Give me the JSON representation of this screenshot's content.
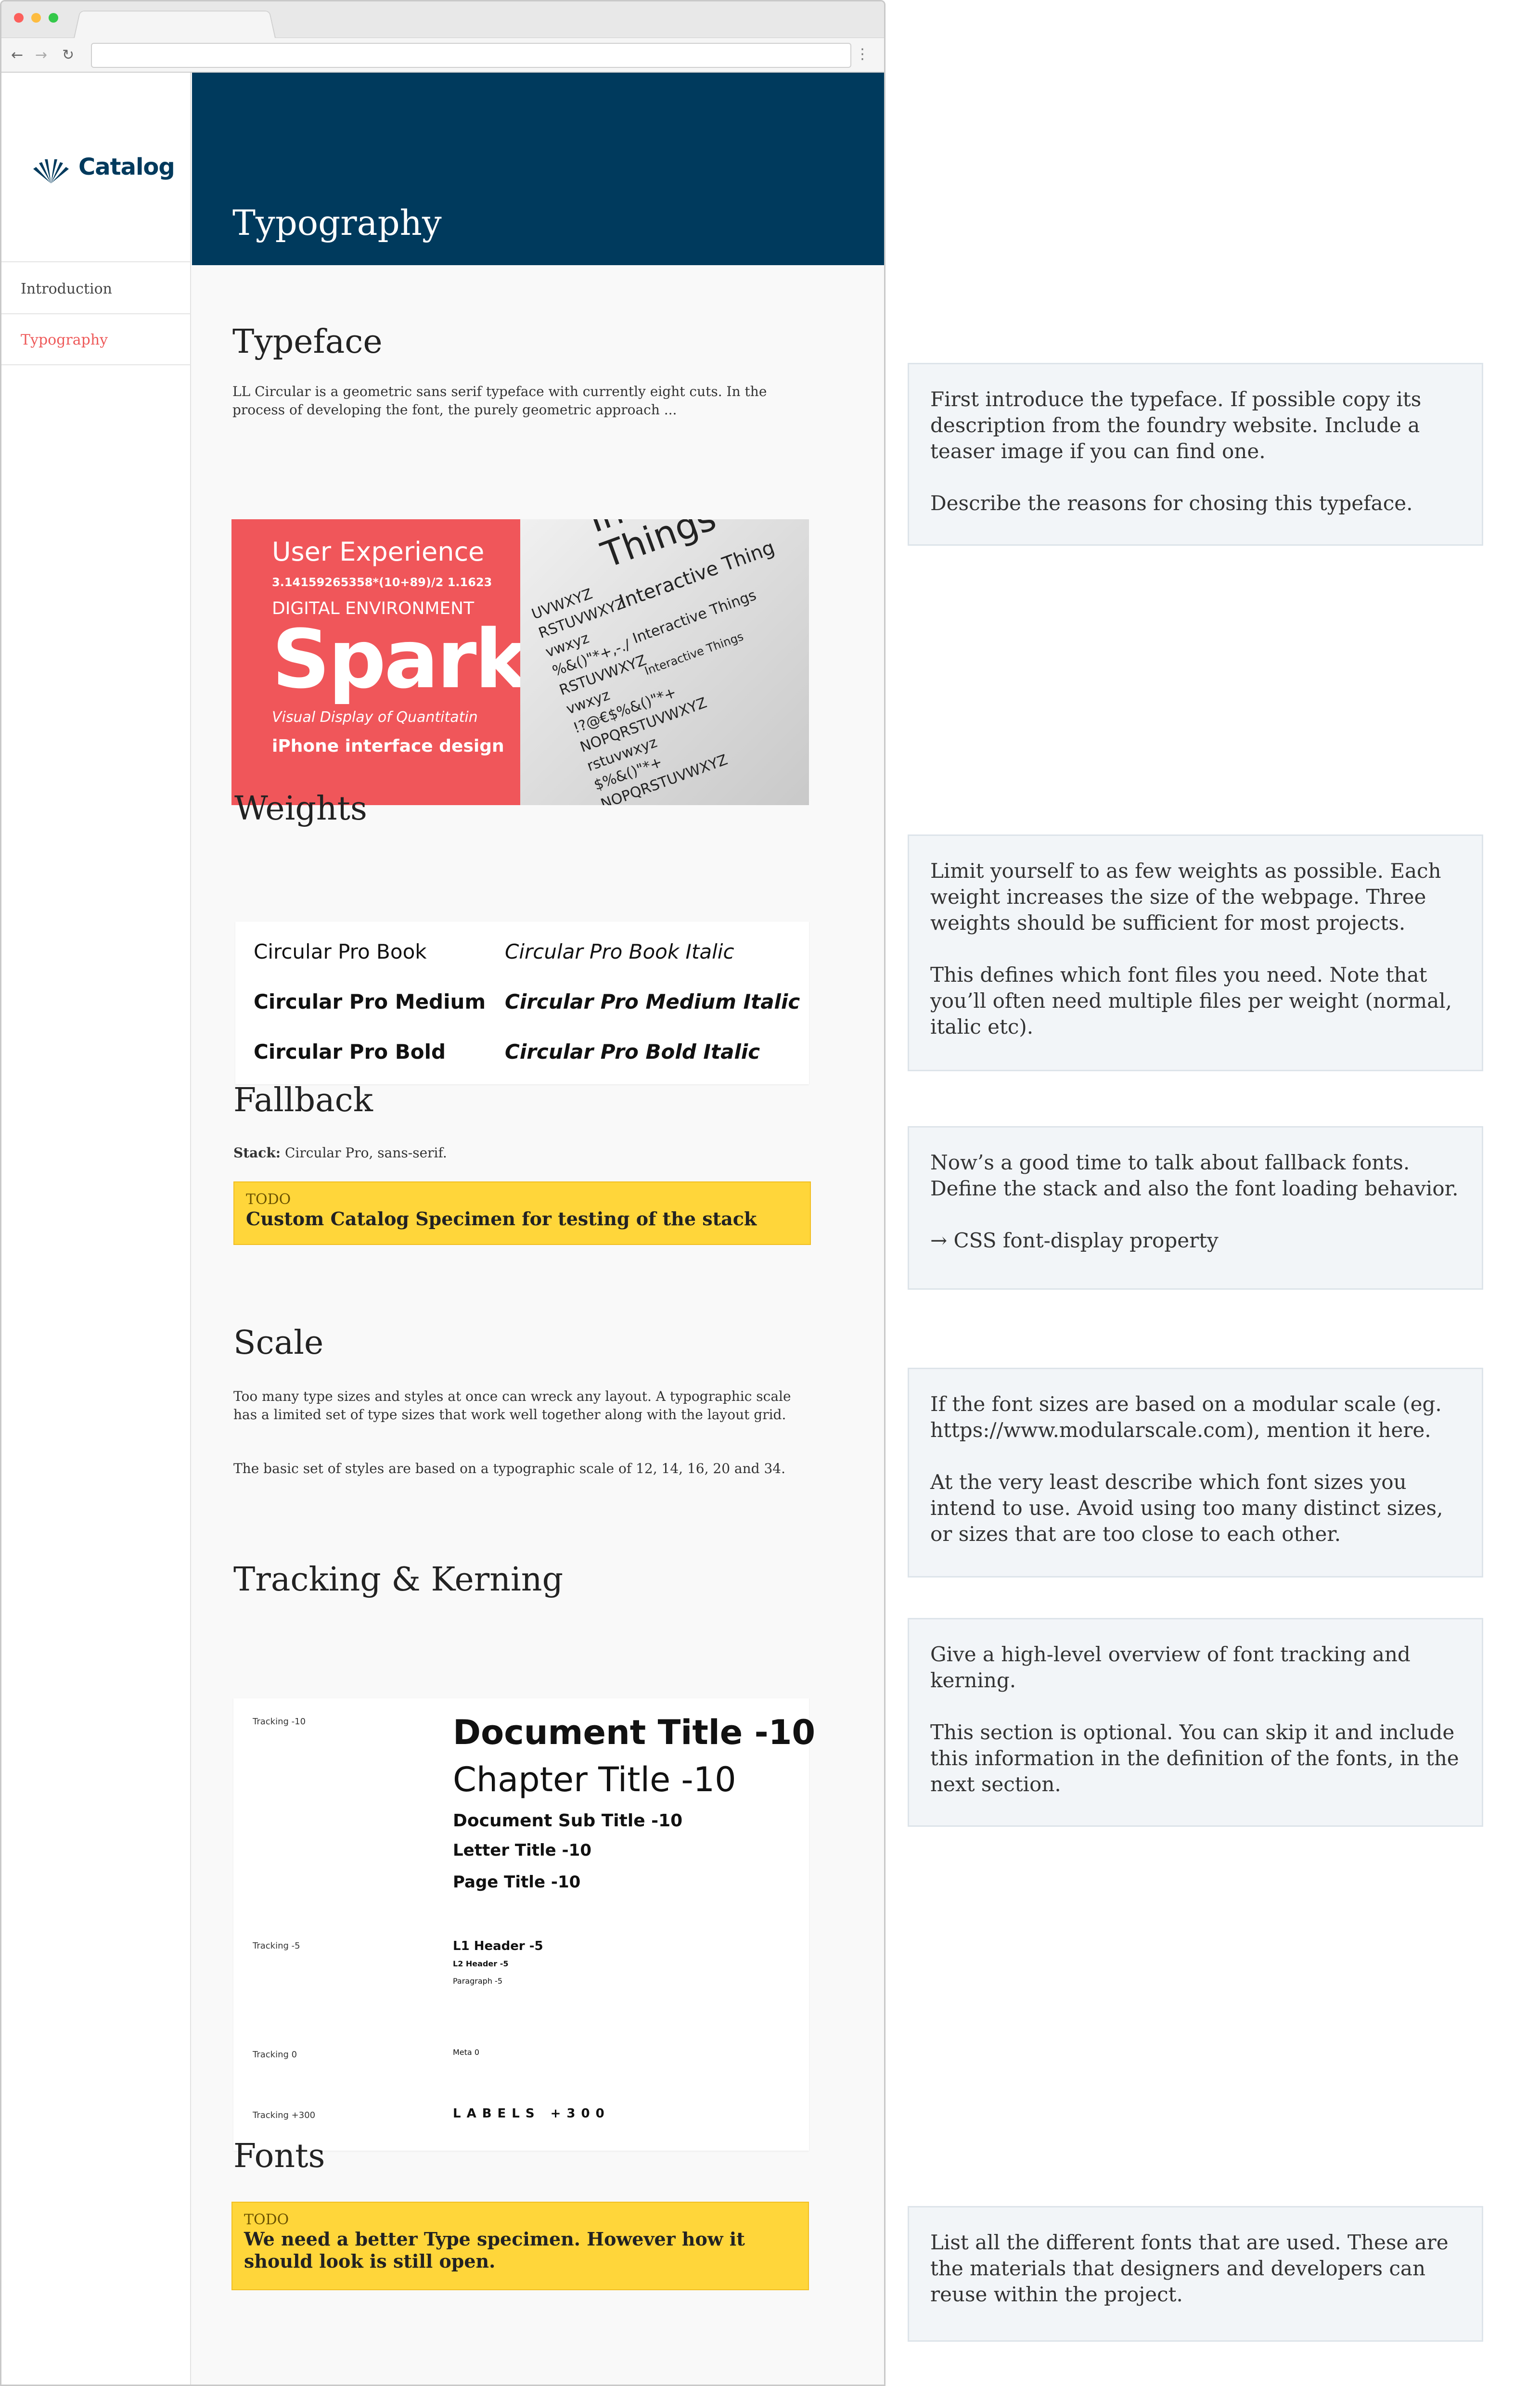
{
  "browser": {
    "url": "",
    "back_icon": "←",
    "forward_icon": "→",
    "reload_icon": "↻",
    "menu_icon": "⋮"
  },
  "sidebar": {
    "logo_text": "Catalog",
    "items": [
      {
        "label": "Introduction",
        "active": false
      },
      {
        "label": "Typography",
        "active": true
      }
    ]
  },
  "header": {
    "title": "Typography"
  },
  "sections": {
    "typeface": {
      "heading": "Typeface",
      "text": "LL Circular is a geometric sans serif typeface with currently eight cuts. In the process of developing the font, the purely geometric approach ...",
      "image": {
        "ux": "User Experience",
        "numbers": "3.14159265358*(10+89)/2   1.1623",
        "digital": "DIGITAL ENVIRONMENT",
        "spark": "Spark",
        "visual": "Visual Display of Quantitatin",
        "iphone": "iPhone interface design",
        "alphabet": "UVWXYZ\nRSTUVWXYZ\nvwxyz\n%&()\"*+,-./\nRSTUVWXYZ\nvwxyz\n!?@€$%&()\"*+\nNOPQRSTUVWXYZ\nrstuvwxyz\n$%&()\"*+\nNOPQRSTUVWXYZ\nwxyz\n@€$%&()\"*",
        "interactive_big": "Interactive Things",
        "interactive": "Interactive Thing"
      }
    },
    "weights": {
      "heading": "Weights",
      "items": [
        "Circular Pro Book",
        "Circular Pro Book Italic",
        "Circular Pro Medium",
        "Circular Pro Medium Italic",
        "Circular Pro Bold",
        "Circular Pro Bold Italic"
      ]
    },
    "fallback": {
      "heading": "Fallback",
      "stack_label": "Stack:",
      "stack_value": "Circular Pro, sans-serif.",
      "todo_label": "TODO",
      "todo_text": "Custom Catalog Specimen for testing of the stack"
    },
    "scale": {
      "heading": "Scale",
      "text1": "Too many type sizes and styles at once can wreck any layout. A typographic scale has a limited set of type sizes that work well together along with the layout grid.",
      "text2": "The basic set of styles are based on a typographic scale of 12, 14, 16, 20 and 34."
    },
    "tracking": {
      "heading": "Tracking & Kerning",
      "rows": [
        {
          "label": "Tracking -10"
        },
        {
          "label": "Tracking -5"
        },
        {
          "label": "Tracking 0"
        },
        {
          "label": "Tracking +300"
        }
      ],
      "samples": {
        "doc_title": "Document Title -10",
        "chapter_title": "Chapter Title -10",
        "doc_sub": "Document Sub Title -10",
        "letter_title": "Letter Title -10",
        "page_title": "Page Title -10",
        "l1": "L1 Header -5",
        "l2": "L2 Header -5",
        "paragraph": "Paragraph -5",
        "meta": "Meta 0",
        "labels": "LABELS +300"
      }
    },
    "fonts": {
      "heading": "Fonts",
      "todo_label": "TODO",
      "todo_text": "We need a better Type specimen. However how it should look is still open."
    }
  },
  "notes": [
    "First introduce the typeface. If possible copy its description from the foundry website. Include a teaser image if you can find one.\n\nDescribe the reasons for chosing this typeface.",
    "Limit yourself to as few weights as possible. Each weight increases the size of the webpage. Three weights should be sufficient for most projects.\n\nThis defines which font files you need. Note that you’ll often need multiple files per weight (normal, italic etc).",
    "Now’s a good time to talk about fallback fonts. Define the stack and also the font loading behavior.\n\n→ CSS font-display property",
    "If the font sizes are based on a modular scale (eg. https://www.modularscale.com), mention it here.\n\nAt the very least describe which font sizes you intend to use. Avoid using too many distinct sizes, or sizes that are too close to each other.",
    "Give a high-level overview of font tracking and kerning.\n\nThis section is optional. You can skip it and include this information in the definition of the fonts, in the next section.",
    "List all the different fonts that are used. These are the materials that designers and developers can reuse within the project."
  ],
  "colors": {
    "header_bg": "#003a5d",
    "accent_red": "#f0565a",
    "active_link": "#ee5a5a",
    "todo_bg": "#ffd63a",
    "note_bg": "#f2f5f8"
  }
}
